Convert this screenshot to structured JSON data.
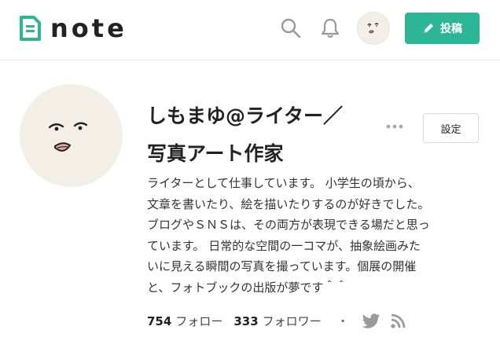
{
  "header": {
    "logo_text": "note",
    "post_button_label": "投稿",
    "icons": [
      "search-icon",
      "bell-icon",
      "user-avatar",
      "pen-icon"
    ]
  },
  "profile": {
    "name": "しもまゆ@ライター／\n写真アート作家",
    "settings_label": "設定",
    "bio": "ライターとして仕事しています。 小学生の頃から、\n文章を書いたり、絵を描いたりするのが好きでした。\nブログやＳＮＳは、その両方が表現できる場だと思っ\nています。 日常的な空間の一コマが、抽象絵画みた\nいに見える瞬間の写真を撮っています。個展の開催\nと、フォトブックの出版が夢です＾＾",
    "follow_count": "754",
    "follow_label": "フォロー",
    "follower_count": "333",
    "follower_label": "フォロワー",
    "separator": "・"
  },
  "colors": {
    "brand": "#2cb696",
    "icon_gray": "#999999",
    "avatar_bg": "#f3efe6"
  }
}
